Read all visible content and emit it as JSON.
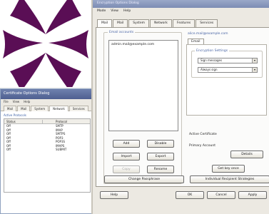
{
  "background_window": {
    "title": "Certificate Options Dialog",
    "menu": [
      "File",
      "View",
      "Help"
    ],
    "tabs": [
      "Mail",
      "Mail",
      "System",
      "Network",
      "Services"
    ],
    "group_label": "Active Protocols",
    "columns": [
      "Status",
      "Protocol"
    ],
    "rows": [
      {
        "status": "Off",
        "protocol": "SMTP"
      },
      {
        "status": "Off",
        "protocol": "IMAP"
      },
      {
        "status": "Off",
        "protocol": "SMTPS"
      },
      {
        "status": "Off",
        "protocol": "POP3"
      },
      {
        "status": "Off",
        "protocol": "POP3S"
      },
      {
        "status": "Off",
        "protocol": "IMAPS"
      },
      {
        "status": "Off",
        "protocol": "SUBMIT"
      }
    ]
  },
  "dialog": {
    "title": "Encryption Options Dialog",
    "menu": [
      "Mode",
      "View",
      "Help"
    ],
    "tabs": [
      "Mail",
      "Mail",
      "System",
      "Network",
      "Features",
      "Services"
    ],
    "accounts_group": "Email accounts",
    "accounts": [
      "admin.mail@example.com"
    ],
    "buttons": {
      "add": "Add",
      "disable": "Disable",
      "import": "Import",
      "export": "Export",
      "copy": "Copy",
      "rename": "Rename",
      "change_passphrase": "Change Passphrase",
      "individual_recipient": "Individual Recipient Strategies",
      "help": "Help",
      "ok": "OK",
      "cancel": "Cancel",
      "apply": "Apply",
      "details": "Details",
      "get_key": "Get key once"
    },
    "details_title": "alice.mail@example.com",
    "details_tab": "Email",
    "security_title": "Encryption Settings",
    "security_values": [
      "Sign messages",
      "Always sign"
    ],
    "active_certificate_label": "Active Certificate",
    "primary_account_label": "Primary Account"
  }
}
